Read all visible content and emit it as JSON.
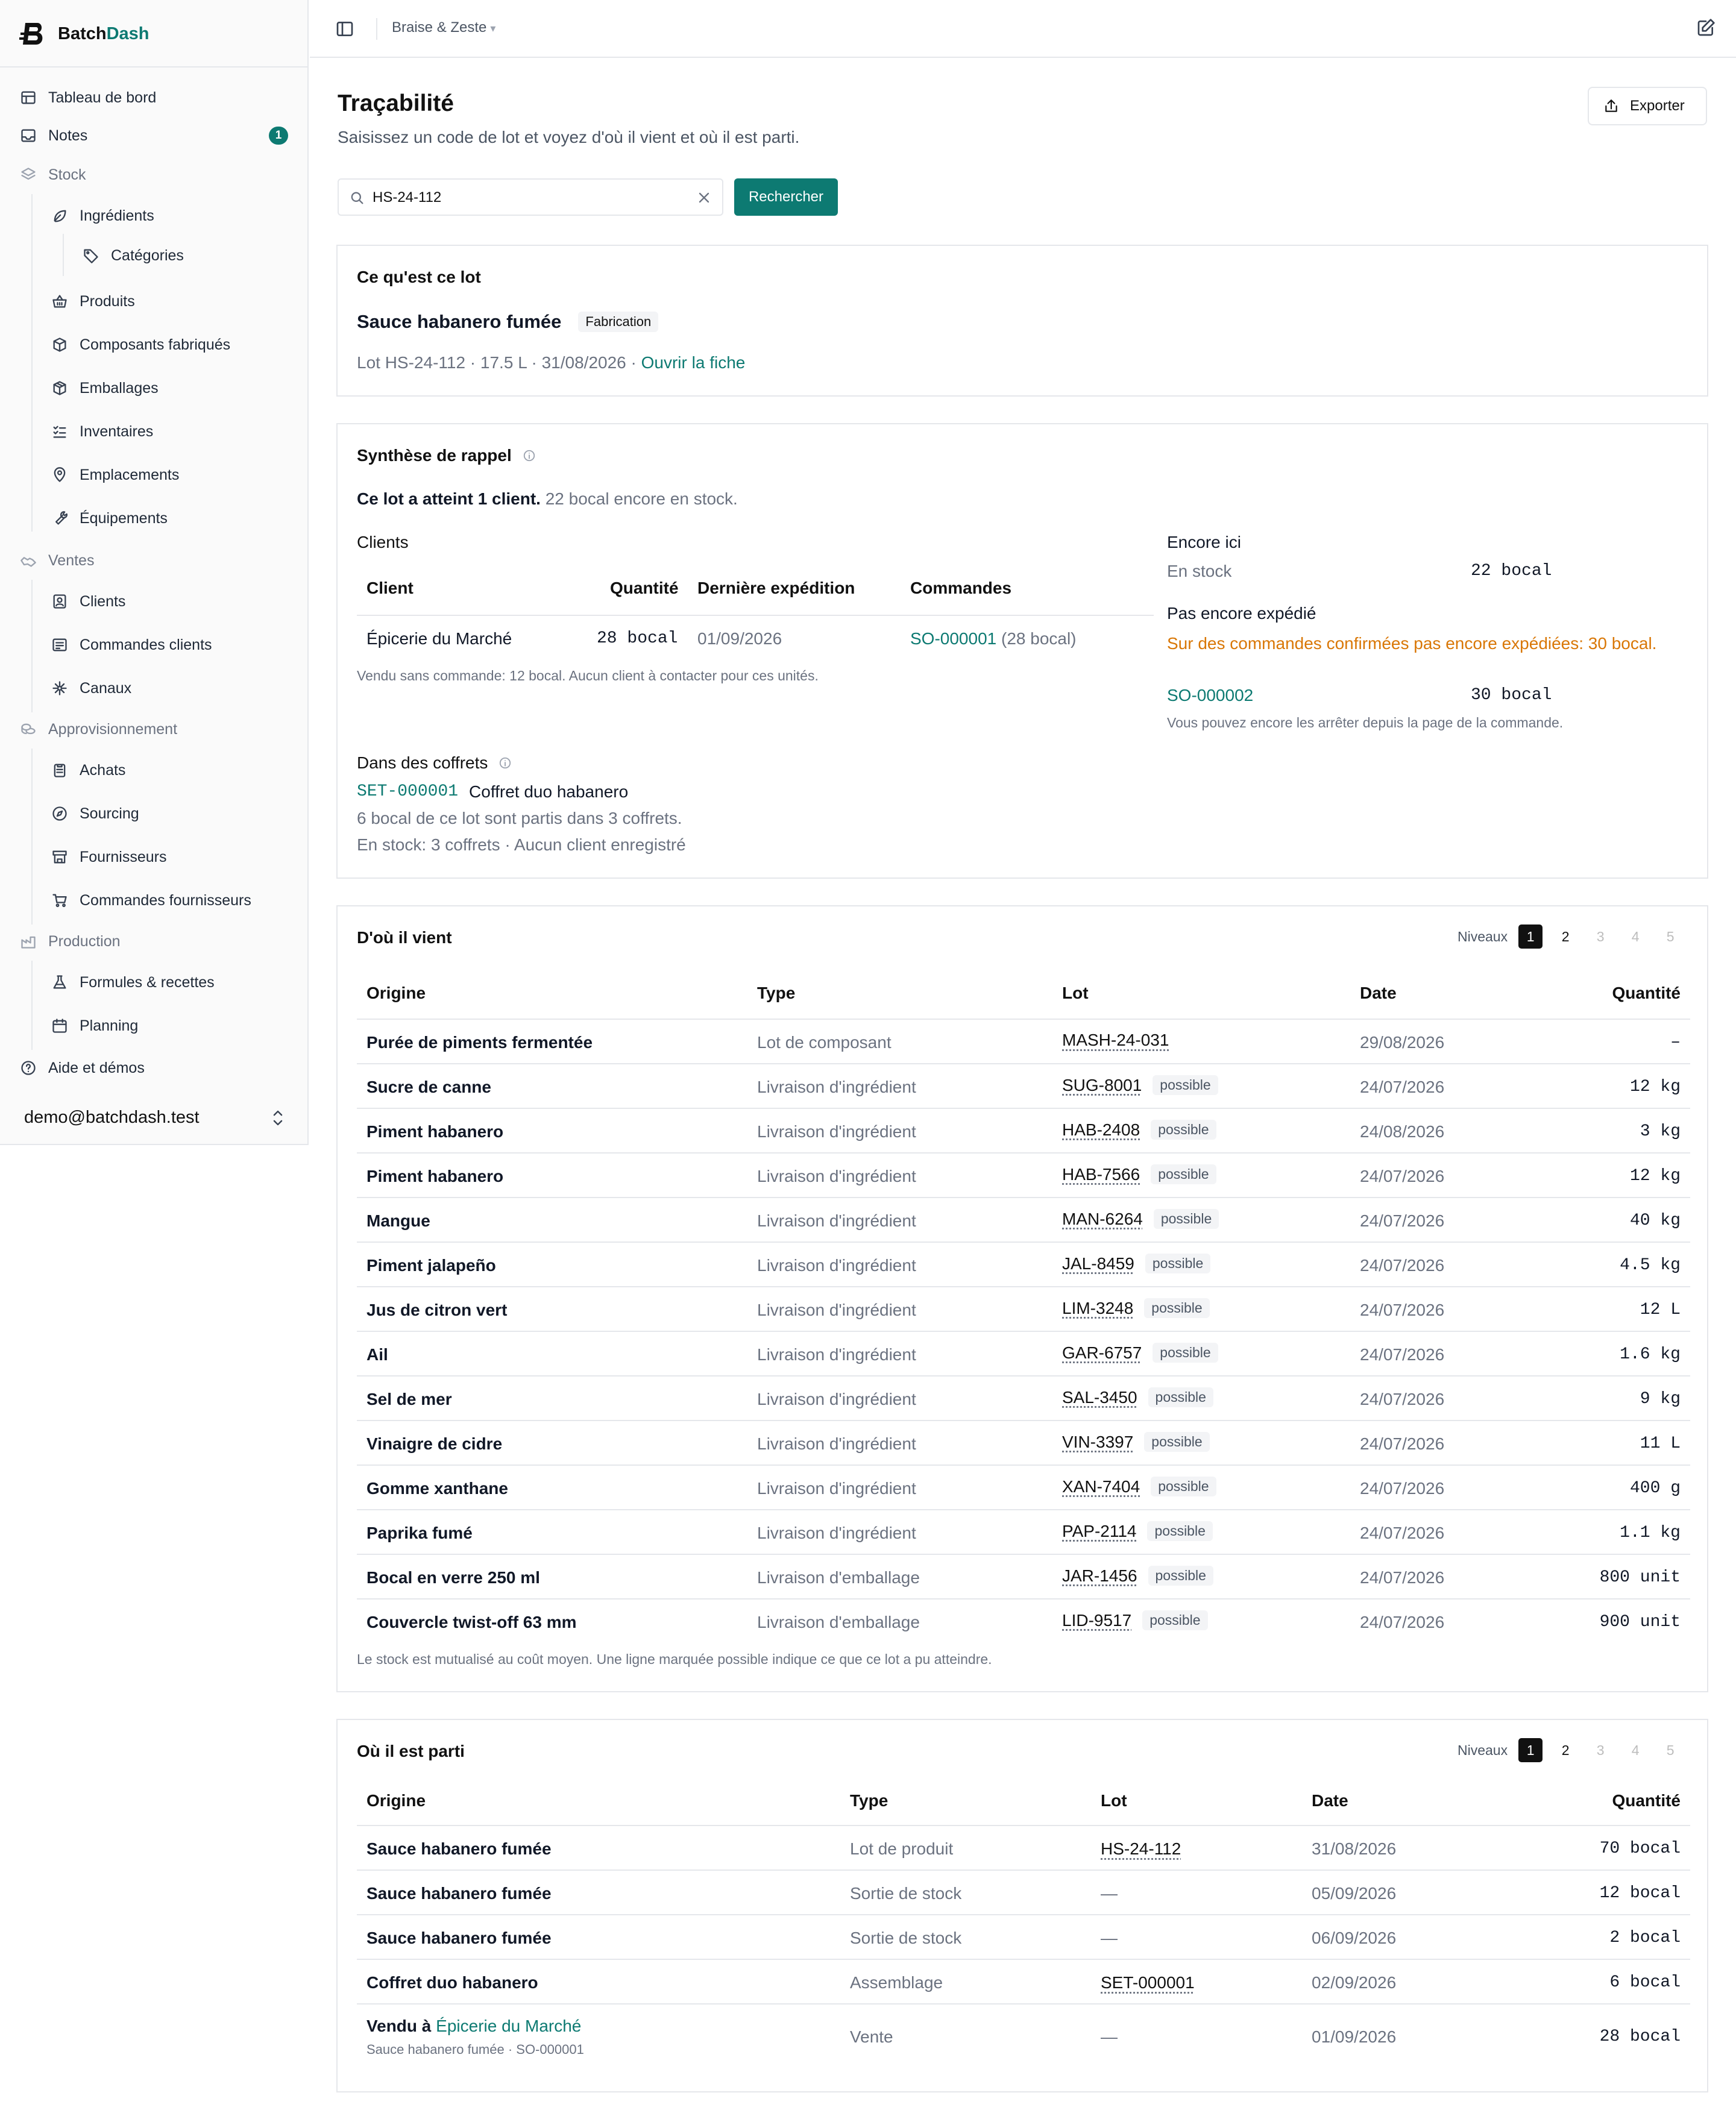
{
  "app": {
    "brand_prefix": "Batch",
    "brand_suffix": "Dash"
  },
  "sidebar": {
    "dashboard": "Tableau de bord",
    "notes": "Notes",
    "notes_badge": "1",
    "stock": "Stock",
    "ingredients": "Ingrédients",
    "categories": "Catégories",
    "products": "Produits",
    "components": "Composants fabriqués",
    "packaging": "Emballages",
    "inventories": "Inventaires",
    "locations": "Emplacements",
    "equipment": "Équipements",
    "sales": "Ventes",
    "clients": "Clients",
    "client_orders": "Commandes clients",
    "channels": "Canaux",
    "supply": "Approvisionnement",
    "purchases": "Achats",
    "sourcing": "Sourcing",
    "suppliers": "Fournisseurs",
    "supplier_orders": "Commandes fournisseurs",
    "production": "Production",
    "recipes": "Formules & recettes",
    "planning": "Planning",
    "help": "Aide et démos",
    "user": "demo@batchdash.test"
  },
  "topbar": {
    "workspace": "Braise & Zeste"
  },
  "page": {
    "title": "Traçabilité",
    "subtitle": "Saisissez un code de lot et voyez d'où il vient et où il est parti.",
    "export": "Exporter"
  },
  "search": {
    "value": "HS-24-112",
    "button": "Rechercher"
  },
  "lot": {
    "heading": "Ce qu'est ce lot",
    "name": "Sauce habanero fumée",
    "tag": "Fabrication",
    "meta": "Lot HS-24-112 · 17.5 L · 31/08/2026 · ",
    "open_link": "Ouvrir la fiche"
  },
  "recall": {
    "heading": "Synthèse de rappel",
    "reached_bold": "Ce lot a atteint 1 client.",
    "reached_rest": " 22 bocal encore en stock.",
    "clients_heading": "Clients",
    "col_client": "Client",
    "col_qty": "Quantité",
    "col_last": "Dernière expédition",
    "col_orders": "Commandes",
    "client_name": "Épicerie du Marché",
    "client_qty": "28 bocal",
    "client_date": "01/09/2026",
    "client_order": "SO-000001",
    "client_order_qty": " (28 bocal)",
    "sold_note": "Vendu sans commande: 12 bocal. Aucun client à contacter pour ces unités.",
    "here_heading": "Encore ici",
    "in_stock_label": "En stock",
    "in_stock_value": "22 bocal",
    "not_shipped_heading": "Pas encore expédié",
    "not_shipped_warning": "Sur des commandes confirmées pas encore expédiées: 30 bocal.",
    "pending_order": "SO-000002",
    "pending_qty": "30 bocal",
    "pending_note": "Vous pouvez encore les arrêter depuis la page de la commande.",
    "sets_heading": "Dans des coffrets",
    "set_code": "SET-000001",
    "set_name": "Coffret duo habanero",
    "set_line1": "6 bocal de ce lot sont partis dans 3 coffrets.",
    "set_line2": "En stock: 3 coffrets · Aucun client enregistré"
  },
  "origin": {
    "heading": "D'où il vient",
    "levels_label": "Niveaux",
    "levels": [
      "1",
      "2",
      "3",
      "4",
      "5"
    ],
    "columns": [
      "Origine",
      "Type",
      "Lot",
      "Date",
      "Quantité"
    ],
    "possible": "possible",
    "rows": [
      {
        "name": "Purée de piments fermentée",
        "type": "Lot de composant",
        "lot": "MASH-24-031",
        "possible": false,
        "date": "29/08/2026",
        "qty": "–"
      },
      {
        "name": "Sucre de canne",
        "type": "Livraison d'ingrédient",
        "lot": "SUG-8001",
        "possible": true,
        "date": "24/07/2026",
        "qty": "12 kg"
      },
      {
        "name": "Piment habanero",
        "type": "Livraison d'ingrédient",
        "lot": "HAB-2408",
        "possible": true,
        "date": "24/08/2026",
        "qty": "3 kg"
      },
      {
        "name": "Piment habanero",
        "type": "Livraison d'ingrédient",
        "lot": "HAB-7566",
        "possible": true,
        "date": "24/07/2026",
        "qty": "12 kg"
      },
      {
        "name": "Mangue",
        "type": "Livraison d'ingrédient",
        "lot": "MAN-6264",
        "possible": true,
        "date": "24/07/2026",
        "qty": "40 kg"
      },
      {
        "name": "Piment jalapeño",
        "type": "Livraison d'ingrédient",
        "lot": "JAL-8459",
        "possible": true,
        "date": "24/07/2026",
        "qty": "4.5 kg"
      },
      {
        "name": "Jus de citron vert",
        "type": "Livraison d'ingrédient",
        "lot": "LIM-3248",
        "possible": true,
        "date": "24/07/2026",
        "qty": "12 L"
      },
      {
        "name": "Ail",
        "type": "Livraison d'ingrédient",
        "lot": "GAR-6757",
        "possible": true,
        "date": "24/07/2026",
        "qty": "1.6 kg"
      },
      {
        "name": "Sel de mer",
        "type": "Livraison d'ingrédient",
        "lot": "SAL-3450",
        "possible": true,
        "date": "24/07/2026",
        "qty": "9 kg"
      },
      {
        "name": "Vinaigre de cidre",
        "type": "Livraison d'ingrédient",
        "lot": "VIN-3397",
        "possible": true,
        "date": "24/07/2026",
        "qty": "11 L"
      },
      {
        "name": "Gomme xanthane",
        "type": "Livraison d'ingrédient",
        "lot": "XAN-7404",
        "possible": true,
        "date": "24/07/2026",
        "qty": "400 g"
      },
      {
        "name": "Paprika fumé",
        "type": "Livraison d'ingrédient",
        "lot": "PAP-2114",
        "possible": true,
        "date": "24/07/2026",
        "qty": "1.1 kg"
      },
      {
        "name": "Bocal en verre 250 ml",
        "type": "Livraison d'emballage",
        "lot": "JAR-1456",
        "possible": true,
        "date": "24/07/2026",
        "qty": "800 unit"
      },
      {
        "name": "Couvercle twist-off 63 mm",
        "type": "Livraison d'emballage",
        "lot": "LID-9517",
        "possible": true,
        "date": "24/07/2026",
        "qty": "900 unit"
      }
    ],
    "footnote": "Le stock est mutualisé au coût moyen. Une ligne marquée possible indique ce que ce lot a pu atteindre."
  },
  "destination": {
    "heading": "Où il est parti",
    "levels_label": "Niveaux",
    "levels": [
      "1",
      "2",
      "3",
      "4",
      "5"
    ],
    "columns": [
      "Origine",
      "Type",
      "Lot",
      "Date",
      "Quantité"
    ],
    "rows": [
      {
        "name": "Sauce habanero fumée",
        "type": "Lot de produit",
        "lot": "HS-24-112",
        "date": "31/08/2026",
        "qty": "70 bocal"
      },
      {
        "name": "Sauce habanero fumée",
        "type": "Sortie de stock",
        "lot": "—",
        "date": "05/09/2026",
        "qty": "12 bocal"
      },
      {
        "name": "Sauce habanero fumée",
        "type": "Sortie de stock",
        "lot": "—",
        "date": "06/09/2026",
        "qty": "2 bocal"
      },
      {
        "name": "Coffret duo habanero",
        "type": "Assemblage",
        "lot": "SET-000001",
        "date": "02/09/2026",
        "qty": "6 bocal"
      }
    ],
    "sale": {
      "prefix": "Vendu à ",
      "client": "Épicerie du Marché",
      "sub": "Sauce habanero fumée · SO-000001",
      "type": "Vente",
      "lot": "—",
      "date": "01/09/2026",
      "qty": "28 bocal"
    }
  },
  "colors": {
    "accent": "#0d7a72",
    "warning": "#d97706",
    "border": "#e5e7eb"
  }
}
